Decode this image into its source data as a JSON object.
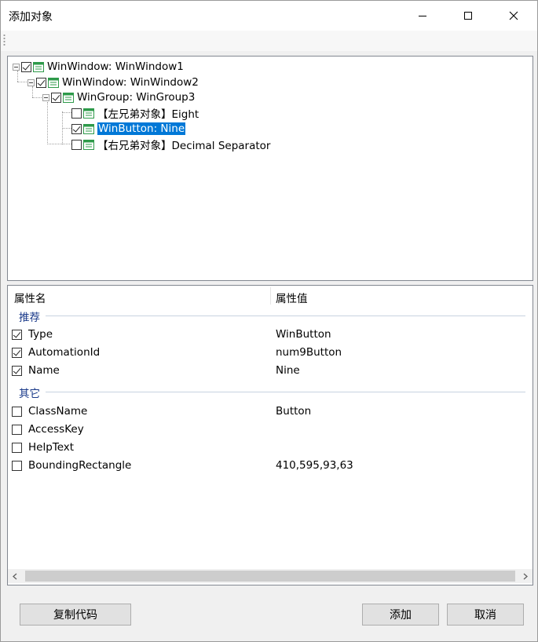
{
  "window": {
    "title": "添加对象"
  },
  "tree": {
    "nodes": [
      {
        "label": "WinWindow: WinWindow1",
        "checked": true
      },
      {
        "label": "WinWindow: WinWindow2",
        "checked": true
      },
      {
        "label": "WinGroup: WinGroup3",
        "checked": true
      },
      {
        "label": "【左兄弟对象】Eight",
        "checked": false
      },
      {
        "label": "WinButton: Nine",
        "checked": true,
        "selected": true
      },
      {
        "label": "【右兄弟对象】Decimal Separator",
        "checked": false
      }
    ]
  },
  "props": {
    "col_name": "属性名",
    "col_value": "属性值",
    "groups": [
      {
        "title": "推荐",
        "rows": [
          {
            "name": "Type",
            "value": "WinButton",
            "checked": true
          },
          {
            "name": "AutomationId",
            "value": "num9Button",
            "checked": true
          },
          {
            "name": "Name",
            "value": "Nine",
            "checked": true
          }
        ]
      },
      {
        "title": "其它",
        "rows": [
          {
            "name": "ClassName",
            "value": "Button",
            "checked": false
          },
          {
            "name": "AccessKey",
            "value": "",
            "checked": false
          },
          {
            "name": "HelpText",
            "value": "",
            "checked": false
          },
          {
            "name": "BoundingRectangle",
            "value": "410,595,93,63",
            "checked": false
          }
        ]
      }
    ]
  },
  "buttons": {
    "copy": "复制代码",
    "add": "添加",
    "cancel": "取消"
  },
  "colors": {
    "selection": "#0078d7",
    "group_header": "#1a3a8a",
    "node_icon": "#2e9a4a"
  }
}
